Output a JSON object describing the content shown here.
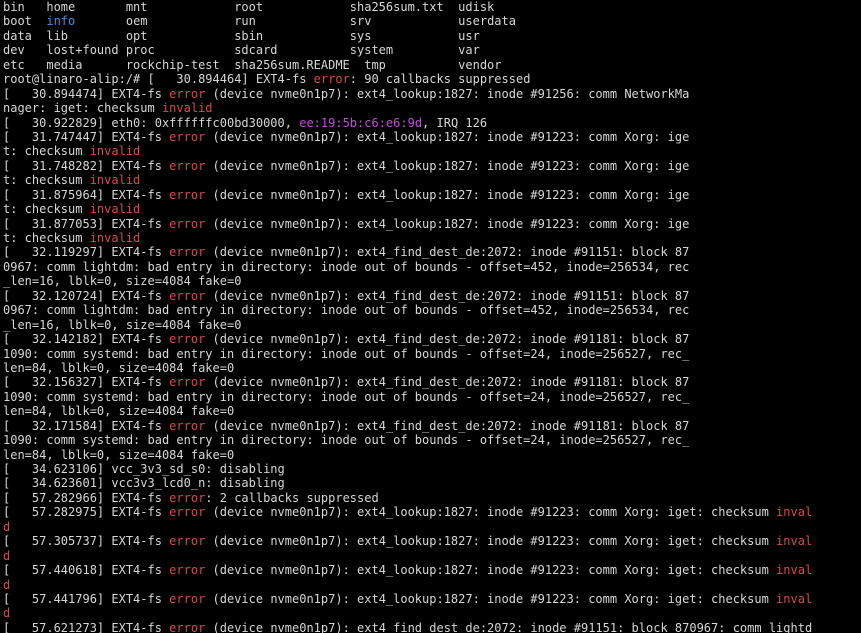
{
  "colors": {
    "background": "#000000",
    "text": "#d6d6d6",
    "directory": "#3b8eea",
    "error": "#d64a4a",
    "mac_address": "#c24cd8"
  },
  "lines": [
    [
      {
        "t": "bin   home       mnt            root            sha256sum.txt  udisk",
        "c": "plain"
      }
    ],
    [
      {
        "t": "boot  ",
        "c": "plain"
      },
      {
        "t": "info",
        "c": "blue"
      },
      {
        "t": "       oem            run             srv            userdata",
        "c": "plain"
      }
    ],
    [
      {
        "t": "data  lib        opt            sbin            sys            usr",
        "c": "plain"
      }
    ],
    [
      {
        "t": "dev   lost+found proc           sdcard          system         var",
        "c": "plain"
      }
    ],
    [
      {
        "t": "etc   media      rockchip-test  sha256sum.README  tmp          vendor",
        "c": "plain"
      }
    ],
    [
      {
        "t": "root@linaro-alip:/# [   30.894464] EXT4-fs ",
        "c": "plain"
      },
      {
        "t": "error",
        "c": "red"
      },
      {
        "t": ": 90 callbacks suppressed",
        "c": "plain"
      }
    ],
    [
      {
        "t": "[   30.894474] EXT4-fs ",
        "c": "plain"
      },
      {
        "t": "error",
        "c": "red"
      },
      {
        "t": " (device nvme0n1p7): ext4_lookup:1827: inode #91256: comm NetworkMa",
        "c": "plain"
      }
    ],
    [
      {
        "t": "nager: iget: checksum ",
        "c": "plain"
      },
      {
        "t": "invalid",
        "c": "red"
      }
    ],
    [
      {
        "t": "[   30.922829] eth0: 0xffffffc00bd30000, ",
        "c": "plain"
      },
      {
        "t": "ee:19:5b:c6:e6:9d",
        "c": "mag"
      },
      {
        "t": ", IRQ 126",
        "c": "plain"
      }
    ],
    [
      {
        "t": "[   31.747447] EXT4-fs ",
        "c": "plain"
      },
      {
        "t": "error",
        "c": "red"
      },
      {
        "t": " (device nvme0n1p7): ext4_lookup:1827: inode #91223: comm Xorg: ige",
        "c": "plain"
      }
    ],
    [
      {
        "t": "t: checksum ",
        "c": "plain"
      },
      {
        "t": "invalid",
        "c": "red"
      }
    ],
    [
      {
        "t": "[   31.748282] EXT4-fs ",
        "c": "plain"
      },
      {
        "t": "error",
        "c": "red"
      },
      {
        "t": " (device nvme0n1p7): ext4_lookup:1827: inode #91223: comm Xorg: ige",
        "c": "plain"
      }
    ],
    [
      {
        "t": "t: checksum ",
        "c": "plain"
      },
      {
        "t": "invalid",
        "c": "red"
      }
    ],
    [
      {
        "t": "[   31.875964] EXT4-fs ",
        "c": "plain"
      },
      {
        "t": "error",
        "c": "red"
      },
      {
        "t": " (device nvme0n1p7): ext4_lookup:1827: inode #91223: comm Xorg: ige",
        "c": "plain"
      }
    ],
    [
      {
        "t": "t: checksum ",
        "c": "plain"
      },
      {
        "t": "invalid",
        "c": "red"
      }
    ],
    [
      {
        "t": "[   31.877053] EXT4-fs ",
        "c": "plain"
      },
      {
        "t": "error",
        "c": "red"
      },
      {
        "t": " (device nvme0n1p7): ext4_lookup:1827: inode #91223: comm Xorg: ige",
        "c": "plain"
      }
    ],
    [
      {
        "t": "t: checksum ",
        "c": "plain"
      },
      {
        "t": "invalid",
        "c": "red"
      }
    ],
    [
      {
        "t": "[   32.119297] EXT4-fs ",
        "c": "plain"
      },
      {
        "t": "error",
        "c": "red"
      },
      {
        "t": " (device nvme0n1p7): ext4_find_dest_de:2072: inode #91151: block 87",
        "c": "plain"
      }
    ],
    [
      {
        "t": "0967: comm lightdm: bad entry in directory: inode out of bounds - offset=452, inode=256534, rec",
        "c": "plain"
      }
    ],
    [
      {
        "t": "_len=16, lblk=0, size=4084 fake=0",
        "c": "plain"
      }
    ],
    [
      {
        "t": "[   32.120724] EXT4-fs ",
        "c": "plain"
      },
      {
        "t": "error",
        "c": "red"
      },
      {
        "t": " (device nvme0n1p7): ext4_find_dest_de:2072: inode #91151: block 87",
        "c": "plain"
      }
    ],
    [
      {
        "t": "0967: comm lightdm: bad entry in directory: inode out of bounds - offset=452, inode=256534, rec",
        "c": "plain"
      }
    ],
    [
      {
        "t": "_len=16, lblk=0, size=4084 fake=0",
        "c": "plain"
      }
    ],
    [
      {
        "t": "[   32.142182] EXT4-fs ",
        "c": "plain"
      },
      {
        "t": "error",
        "c": "red"
      },
      {
        "t": " (device nvme0n1p7): ext4_find_dest_de:2072: inode #91181: block 87",
        "c": "plain"
      }
    ],
    [
      {
        "t": "1090: comm systemd: bad entry in directory: inode out of bounds - offset=24, inode=256527, rec_",
        "c": "plain"
      }
    ],
    [
      {
        "t": "len=84, lblk=0, size=4084 fake=0",
        "c": "plain"
      }
    ],
    [
      {
        "t": "[   32.156327] EXT4-fs ",
        "c": "plain"
      },
      {
        "t": "error",
        "c": "red"
      },
      {
        "t": " (device nvme0n1p7): ext4_find_dest_de:2072: inode #91181: block 87",
        "c": "plain"
      }
    ],
    [
      {
        "t": "1090: comm systemd: bad entry in directory: inode out of bounds - offset=24, inode=256527, rec_",
        "c": "plain"
      }
    ],
    [
      {
        "t": "len=84, lblk=0, size=4084 fake=0",
        "c": "plain"
      }
    ],
    [
      {
        "t": "[   32.171584] EXT4-fs ",
        "c": "plain"
      },
      {
        "t": "error",
        "c": "red"
      },
      {
        "t": " (device nvme0n1p7): ext4_find_dest_de:2072: inode #91181: block 87",
        "c": "plain"
      }
    ],
    [
      {
        "t": "1090: comm systemd: bad entry in directory: inode out of bounds - offset=24, inode=256527, rec_",
        "c": "plain"
      }
    ],
    [
      {
        "t": "len=84, lblk=0, size=4084 fake=0",
        "c": "plain"
      }
    ],
    [
      {
        "t": "[   34.623106] vcc_3v3_sd_s0: disabling",
        "c": "plain"
      }
    ],
    [
      {
        "t": "[   34.623601] vcc3v3_lcd0_n: disabling",
        "c": "plain"
      }
    ],
    [
      {
        "t": "[   57.282966] EXT4-fs ",
        "c": "plain"
      },
      {
        "t": "error",
        "c": "red"
      },
      {
        "t": ": 2 callbacks suppressed",
        "c": "plain"
      }
    ],
    [
      {
        "t": "[   57.282975] EXT4-fs ",
        "c": "plain"
      },
      {
        "t": "error",
        "c": "red"
      },
      {
        "t": " (device nvme0n1p7): ext4_lookup:1827: inode #91223: comm Xorg: iget: checksum ",
        "c": "plain"
      },
      {
        "t": "inval",
        "c": "red"
      }
    ],
    [
      {
        "t": "d",
        "c": "red"
      }
    ],
    [
      {
        "t": "[   57.305737] EXT4-fs ",
        "c": "plain"
      },
      {
        "t": "error",
        "c": "red"
      },
      {
        "t": " (device nvme0n1p7): ext4_lookup:1827: inode #91223: comm Xorg: iget: checksum ",
        "c": "plain"
      },
      {
        "t": "inval",
        "c": "red"
      }
    ],
    [
      {
        "t": "d",
        "c": "red"
      }
    ],
    [
      {
        "t": "[   57.440618] EXT4-fs ",
        "c": "plain"
      },
      {
        "t": "error",
        "c": "red"
      },
      {
        "t": " (device nvme0n1p7): ext4_lookup:1827: inode #91223: comm Xorg: iget: checksum ",
        "c": "plain"
      },
      {
        "t": "inval",
        "c": "red"
      }
    ],
    [
      {
        "t": "d",
        "c": "red"
      }
    ],
    [
      {
        "t": "[   57.441796] EXT4-fs ",
        "c": "plain"
      },
      {
        "t": "error",
        "c": "red"
      },
      {
        "t": " (device nvme0n1p7): ext4_lookup:1827: inode #91223: comm Xorg: iget: checksum ",
        "c": "plain"
      },
      {
        "t": "inval",
        "c": "red"
      }
    ],
    [
      {
        "t": "d",
        "c": "red"
      }
    ],
    [
      {
        "t": "[   57.621273] EXT4-fs ",
        "c": "plain"
      },
      {
        "t": "error",
        "c": "red"
      },
      {
        "t": " (device nvme0n1p7): ext4_find_dest_de:2072: inode #91151: block 870967: comm lightd",
        "c": "plain"
      }
    ]
  ]
}
